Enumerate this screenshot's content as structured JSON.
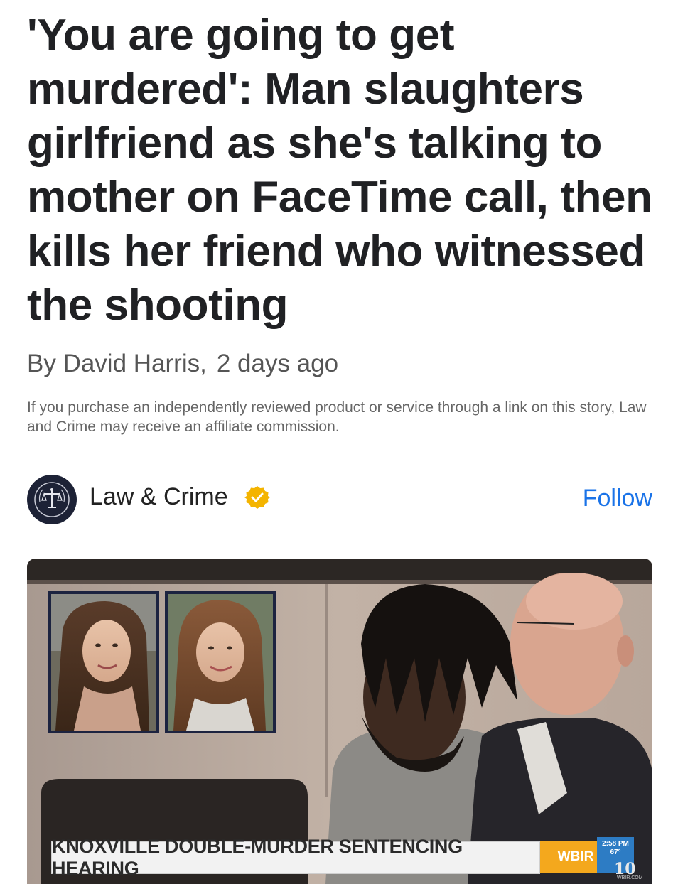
{
  "article": {
    "headline": "'You are going to get murdered': Man slaughters girlfriend as she's talking to mother on FaceTime call, then kills her friend who witnessed the shooting",
    "author_line": "By David Harris,",
    "time_ago": "2 days ago",
    "disclaimer": "If you purchase an independently reviewed product or service through a link on this story, Law and Crime may receive an affiliate commission."
  },
  "source": {
    "name": "Law & Crime",
    "follow_label": "Follow",
    "avatar_icon": "scales-of-justice-icon",
    "verified_icon": "verified-badge-icon",
    "follow_color": "#1a73e8",
    "verified_color": "#f4b400"
  },
  "media": {
    "chyron": "KNOXVILLE DOUBLE-MURDER SENTENCING HEARING",
    "station": "WBIR",
    "time": "2:58 PM",
    "temp": "67°",
    "logo": "10",
    "site": "WBIR.COM",
    "chyron_color": "#f2f2f2",
    "station_color": "#f4a81d"
  }
}
